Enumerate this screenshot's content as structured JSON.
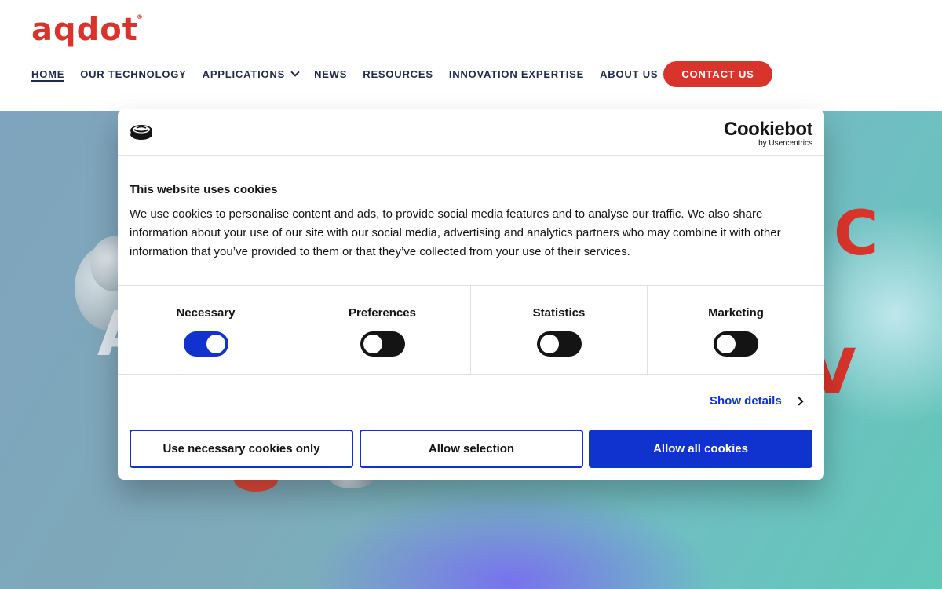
{
  "header": {
    "logo_text": "aqdot",
    "logo_mark": "®",
    "nav": [
      {
        "label": "HOME",
        "active": true,
        "has_dropdown": false
      },
      {
        "label": "OUR TECHNOLOGY",
        "active": false,
        "has_dropdown": false
      },
      {
        "label": "APPLICATIONS",
        "active": false,
        "has_dropdown": true
      },
      {
        "label": "NEWS",
        "active": false,
        "has_dropdown": false
      },
      {
        "label": "RESOURCES",
        "active": false,
        "has_dropdown": false
      },
      {
        "label": "INNOVATION EXPERTISE",
        "active": false,
        "has_dropdown": false
      },
      {
        "label": "ABOUT US",
        "active": false,
        "has_dropdown": true
      }
    ],
    "contact_label": "CONTACT US"
  },
  "hero": {
    "partial_red_1": "C",
    "partial_red_2": "V",
    "partial_white": "A"
  },
  "cookie_dialog": {
    "brand": "Cookiebot",
    "brand_sub": "by Usercentrics",
    "title": "This website uses cookies",
    "body": "We use cookies to personalise content and ads, to provide social media features and to analyse our traffic. We also share information about your use of our site with our social media, advertising and analytics partners who may combine it with other information that you’ve provided to them or that they’ve collected from your use of their services.",
    "categories": [
      {
        "label": "Necessary",
        "enabled": true
      },
      {
        "label": "Preferences",
        "enabled": false
      },
      {
        "label": "Statistics",
        "enabled": false
      },
      {
        "label": "Marketing",
        "enabled": false
      }
    ],
    "show_details_label": "Show details",
    "buttons": {
      "necessary_only": "Use necessary cookies only",
      "allow_selection": "Allow selection",
      "allow_all": "Allow all cookies"
    }
  },
  "colors": {
    "brand_red": "#d9342b",
    "nav_text": "#1e2b4f",
    "cookiebot_blue": "#1032cf",
    "toggle_off": "#141414"
  }
}
